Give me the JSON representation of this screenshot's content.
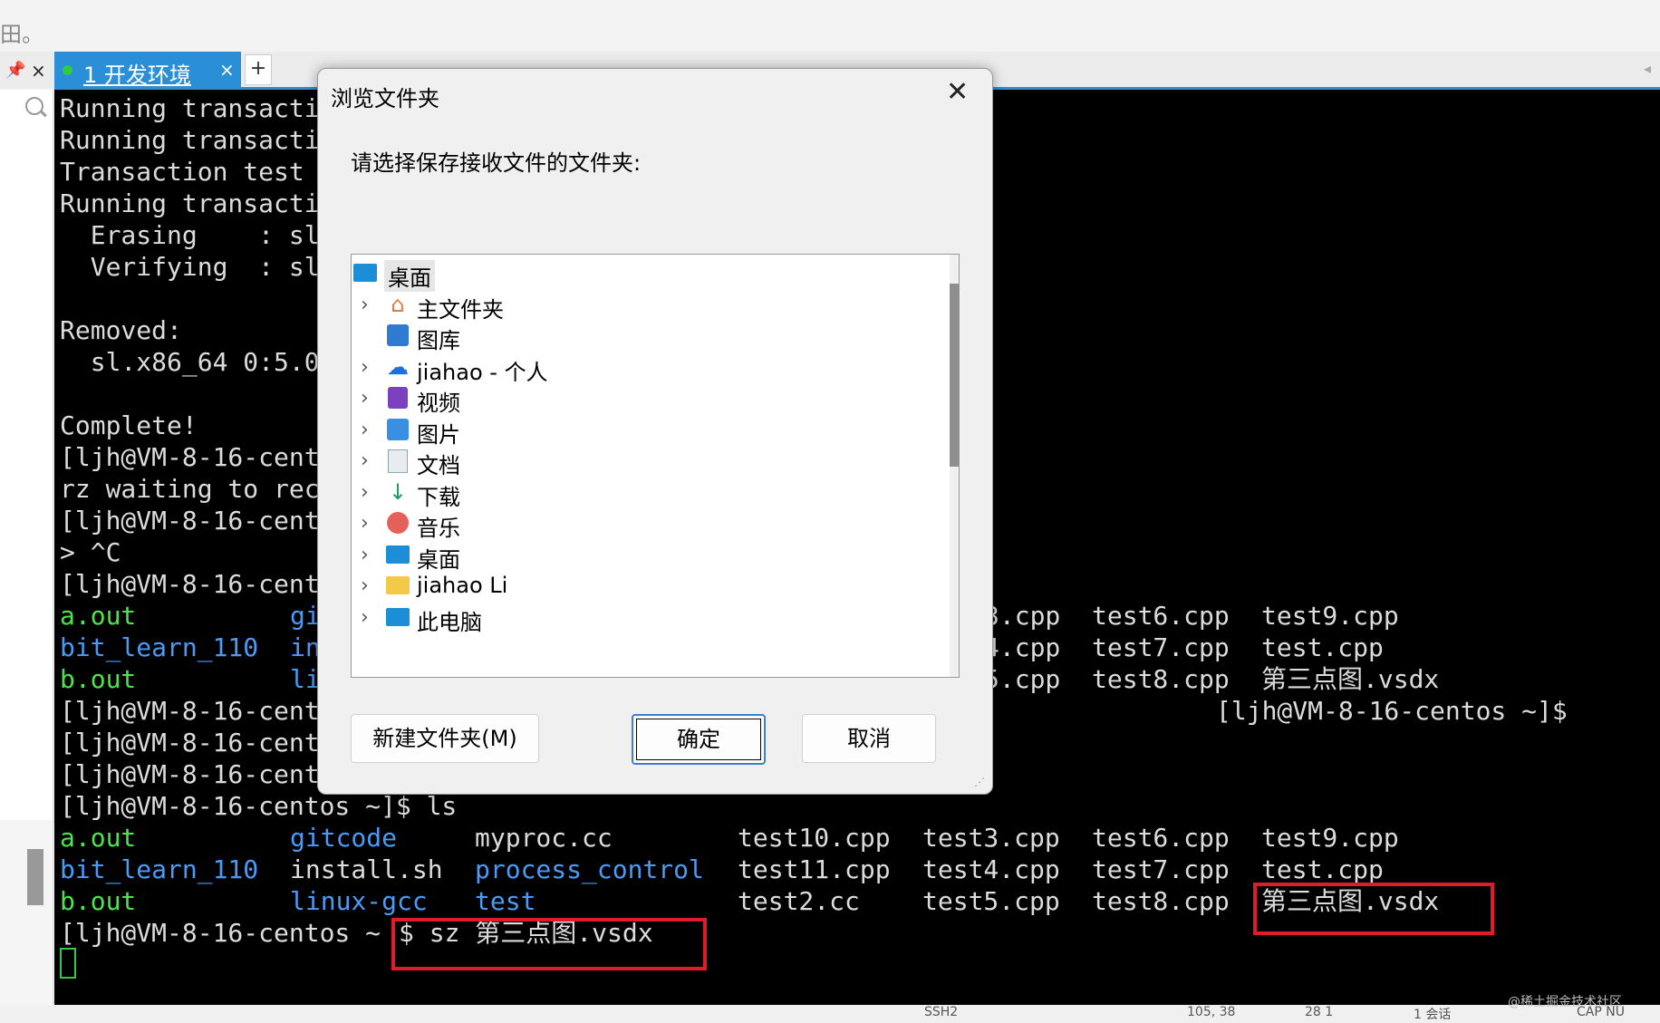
{
  "top_cut_text": "田。",
  "pin_icon": "pushpin-icon",
  "tab": {
    "label": "1 开发环境",
    "close": "×"
  },
  "new_tab": "+",
  "terminal": {
    "lines_top": [
      "Running transacti",
      "Running transacti",
      "Transaction test",
      "Running transacti",
      "  Erasing    : sl",
      "  Verifying  : sl",
      "",
      "Removed:",
      "  sl.x86_64 0:5.0",
      "",
      "Complete!",
      "[ljh@VM-8-16-cent",
      "rz waiting to rec",
      "[ljh@VM-8-16-cent",
      "> ^C",
      "[ljh@VM-8-16-cent"
    ],
    "ls1": [
      {
        "c1": "a.out",
        "c2": "gi",
        "c3": "3.cpp",
        "c4": "test6.cpp",
        "c5": "test9.cpp"
      },
      {
        "c1": "bit_learn_110",
        "c2": "in",
        "c3": "4.cpp",
        "c4": "test7.cpp",
        "c5": "test.cpp"
      },
      {
        "c1": "b.out",
        "c2": "li",
        "c3": "5.cpp",
        "c4": "test8.cpp",
        "c5": "第三点图.vsdx"
      }
    ],
    "prompt_tail": "[ljh@VM-8-16-centos ~]$",
    "prompts": [
      "[ljh@VM-8-16-cent",
      "[ljh@VM-8-16-cent",
      "[ljh@VM-8-16-cent"
    ],
    "ls_cmd": "[ljh@VM-8-16-centos ~]$ ls",
    "ls2": [
      {
        "c1": "a.out",
        "c2": "gitcode",
        "c3": "myproc.cc",
        "c4": "test10.cpp",
        "c5": "test3.cpp",
        "c6": "test6.cpp",
        "c7": "test9.cpp"
      },
      {
        "c1": "bit_learn_110",
        "c2": "install.sh",
        "c3": "process_control",
        "c4": "test11.cpp",
        "c5": "test4.cpp",
        "c6": "test7.cpp",
        "c7": "test.cpp"
      },
      {
        "c1": "b.out",
        "c2": "linux-gcc",
        "c3": "test",
        "c4": "test2.cc",
        "c5": "test5.cpp",
        "c6": "test8.cpp",
        "c7": "第三点图.vsdx"
      }
    ],
    "sz_prompt": "[ljh@VM-8-16-centos ~",
    "sz_cmd": "$ sz 第三点图.vsdx"
  },
  "dialog": {
    "title": "浏览文件夹",
    "prompt": "请选择保存接收文件的文件夹:",
    "items": [
      {
        "label": "桌面",
        "icon": "desktop-icon"
      },
      {
        "label": "主文件夹",
        "icon": "home-icon"
      },
      {
        "label": "图库",
        "icon": "gallery-icon"
      },
      {
        "label": "jiahao - 个人",
        "icon": "onedrive-cloud-icon"
      },
      {
        "label": "视频",
        "icon": "video-icon"
      },
      {
        "label": "图片",
        "icon": "picture-icon"
      },
      {
        "label": "文档",
        "icon": "document-icon"
      },
      {
        "label": "下载",
        "icon": "download-icon"
      },
      {
        "label": "音乐",
        "icon": "music-icon"
      },
      {
        "label": "桌面",
        "icon": "desktop-icon"
      },
      {
        "label": "jiahao Li",
        "icon": "folder-icon"
      },
      {
        "label": "此电脑",
        "icon": "computer-icon"
      }
    ],
    "new_folder": "新建文件夹(M)",
    "ok": "确定",
    "cancel": "取消"
  },
  "status": {
    "ssh": "SSH2",
    "pos": "105, 38",
    "size": "28 1",
    "sessions": "1 会话",
    "caps": "CAP NU",
    "watermark": "@稀土掘金技术社区"
  }
}
